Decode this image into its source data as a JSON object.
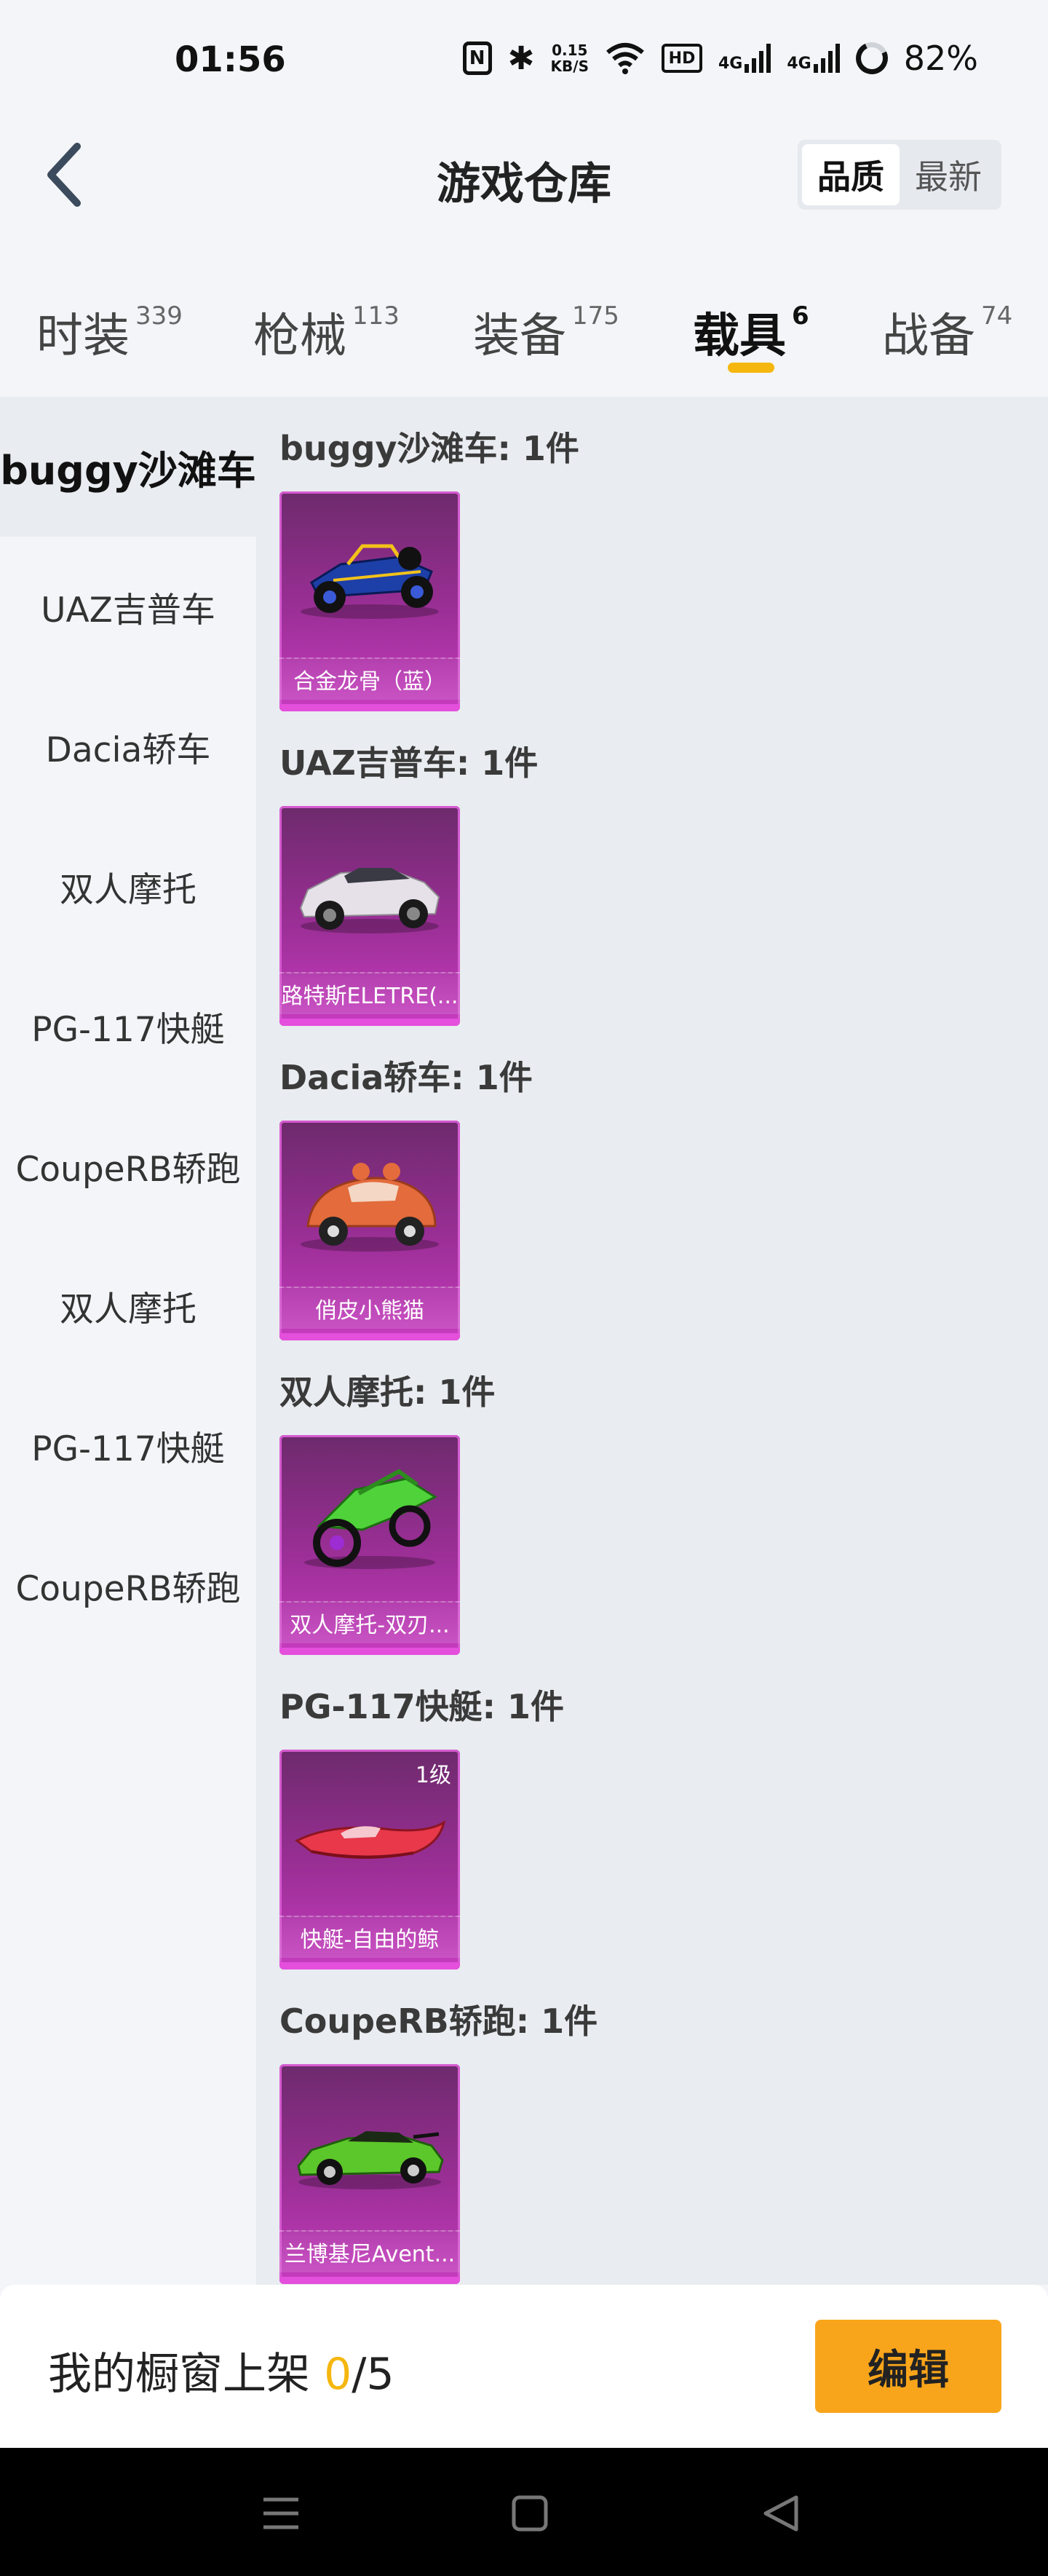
{
  "status_bar": {
    "time": "01:56",
    "nfc": "N",
    "net_speed_value": "0.15",
    "net_speed_unit": "KB/S",
    "hd_label": "HD",
    "sig1_label": "4G",
    "sig2_label": "4G",
    "battery": "82%"
  },
  "header": {
    "title": "游戏仓库",
    "sort_options": [
      "品质",
      "最新"
    ]
  },
  "tabs": [
    {
      "label": "时装",
      "count": "339"
    },
    {
      "label": "枪械",
      "count": "113"
    },
    {
      "label": "装备",
      "count": "175"
    },
    {
      "label": "载具",
      "count": "6"
    },
    {
      "label": "战备",
      "count": "74"
    }
  ],
  "sidebar": {
    "items": [
      "buggy沙滩车",
      "UAZ吉普车",
      "Dacia轿车",
      "双人摩托",
      "PG-117快艇",
      "CoupeRB轿跑",
      "双人摩托",
      "PG-117快艇",
      "CoupeRB轿跑"
    ]
  },
  "sections": [
    {
      "title": "buggy沙滩车: 1件",
      "item_name": "合金龙骨（蓝）",
      "badge": ""
    },
    {
      "title": "UAZ吉普车: 1件",
      "item_name": "路特斯ELETRE(...",
      "badge": ""
    },
    {
      "title": "Dacia轿车: 1件",
      "item_name": "俏皮小熊猫",
      "badge": ""
    },
    {
      "title": "双人摩托: 1件",
      "item_name": "双人摩托-双刃...",
      "badge": ""
    },
    {
      "title": "PG-117快艇: 1件",
      "item_name": "快艇-自由的鲸",
      "badge": "1级"
    },
    {
      "title": "CoupeRB轿跑: 1件",
      "item_name": "兰博基尼Avent...",
      "badge": ""
    }
  ],
  "bottom": {
    "shelf_label": "我的橱窗上架 ",
    "shelf_count": "0",
    "shelf_total": "/5",
    "edit_label": "编辑"
  },
  "colors": {
    "accent": "#f5b60e",
    "button": "#f9a51b",
    "card_purple": "#9c2f97"
  }
}
